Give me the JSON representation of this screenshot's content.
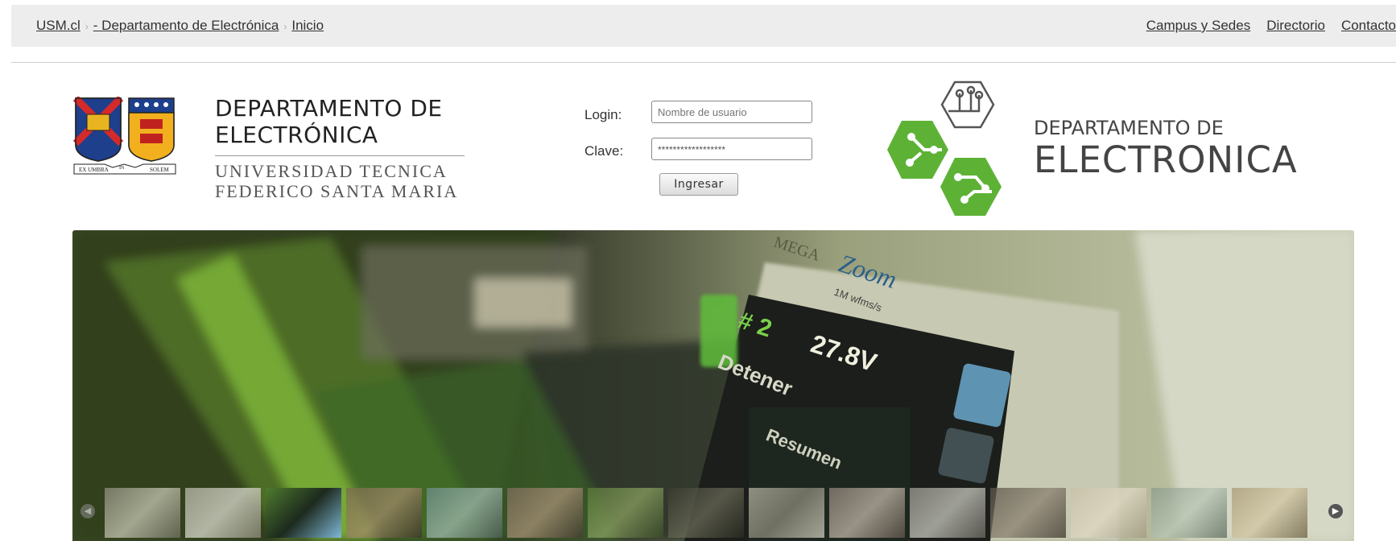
{
  "breadcrumb": {
    "items": [
      "USM.cl",
      "- Departamento de Electrónica",
      "Inicio"
    ]
  },
  "top_links": [
    "Campus y Sedes",
    "Directorio",
    "Contacto"
  ],
  "university": {
    "dept_title_line1": "DEPARTAMENTO DE",
    "dept_title_line2": "ELECTRÓNICA",
    "name_line1": "UNIVERSIDAD TECNICA",
    "name_line2": "FEDERICO SANTA MARIA",
    "crest_motto_left": "EX UMBRA",
    "crest_motto_mid": "IN",
    "crest_motto_right": "SOLEM"
  },
  "login": {
    "login_label": "Login:",
    "login_placeholder": "Nombre de usuario",
    "password_label": "Clave:",
    "password_value": "******************",
    "submit_label": "Ingresar"
  },
  "dept_logo": {
    "line1": "DEPARTAMENTO DE",
    "line2": "ELECTRONICA",
    "color": "#5db236"
  },
  "slider": {
    "device_brand": "MEGA",
    "device_zoom_text": "Zoom",
    "device_rate": "1M wfms/s",
    "readout_channel": "# 2",
    "readout_value": "27.8V",
    "readout_label": "Detener",
    "readout_label2": "Resumen",
    "thumbnail_count": 15,
    "active_thumbnail": 3
  }
}
